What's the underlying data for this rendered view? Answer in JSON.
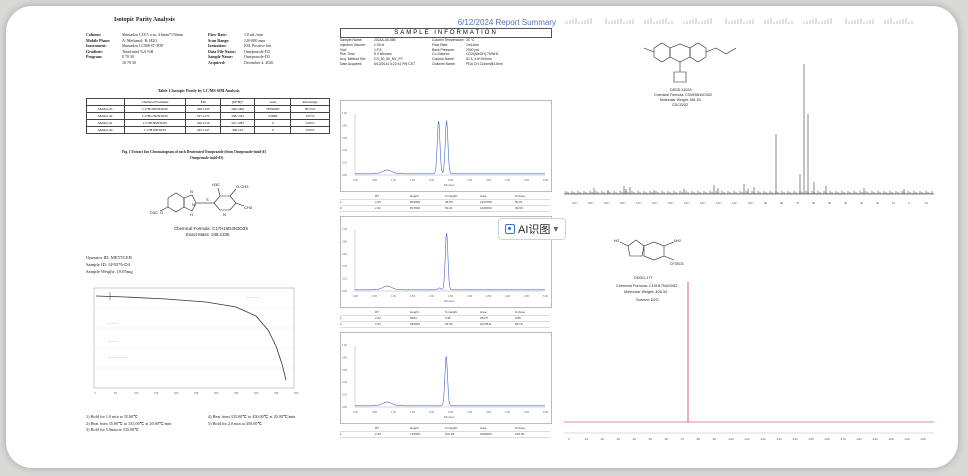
{
  "left_doc": {
    "title": "Isotopic Parity Analysis",
    "params_left": [
      {
        "label": "Column:",
        "value": "Shimadzu C18 5 u m, 4.6mm*150mm"
      },
      {
        "label": "Mobile Phase:",
        "value": "A: Methanol; B: H2O"
      },
      {
        "label": "Instrument:",
        "value": "Shimadzu LCMS-IT-TOF"
      },
      {
        "label": "Gradient:",
        "value": "Time(min)    %A      %B"
      },
      {
        "label": "Program:",
        "value": "0             70      30"
      },
      {
        "label": "",
        "value": "10            70      30"
      }
    ],
    "params_right": [
      {
        "label": "Flow Rate:",
        "value": "1.0 mL/min"
      },
      {
        "label": "Scan Range:",
        "value": "120-800 amu"
      },
      {
        "label": "Ionization:",
        "value": "ESI, Positive Ion"
      },
      {
        "label": "Data File Name:",
        "value": "Omeprazole-D3"
      },
      {
        "label": "Sample Name:",
        "value": "Omeprazole-D3"
      },
      {
        "label": "Acquired:",
        "value": "December 4, 2020"
      }
    ],
    "table_title": "Table 1.Isotopic Purity by LC/MS SIM Analysis",
    "table_headers": [
      "",
      "Chemical Formulae",
      "EM",
      "[M+H]+",
      "Area",
      "Percentage"
    ],
    "table_rows": [
      [
        "Methyl-d3",
        "C17H16D3N3O3S",
        "348.1335",
        "349.1408",
        "78700287",
        "99.55%"
      ],
      [
        "Methyl-d2",
        "C17H17D2N3O3S",
        "347.1273",
        "348.1345",
        "52868",
        "0.07%"
      ],
      [
        "Methyl-d1",
        "C17H18DN3O3S",
        "346.1210",
        "347.1283",
        "0",
        "0.00%"
      ],
      [
        "Methyl-d0",
        "C17H19N3O3S",
        "345.1147",
        "346.122",
        "0",
        "0.00%"
      ]
    ],
    "fig_caption": "Fig. 1   Extract Ion Chromatogram of each Deuterated Omeprazole (from Omeprazole-imid-d3",
    "fig_caption2": "Omeprazole-imid-d3)",
    "structure": {
      "formula": "Chemical Formula: C17H16D3N3O3S",
      "mass": "Exact Mass: 348.1335",
      "labels": [
        "D3C",
        "O",
        "N",
        "H",
        "H3C",
        "O-CH3",
        "CH3",
        "N",
        "S",
        "N"
      ]
    },
    "tga_info": [
      {
        "label": "Operator ID: ",
        "value": "METTLER"
      },
      {
        "label": "Sample ID: ",
        "value": "LF0376-D4"
      },
      {
        "label": "Sample Weight: ",
        "value": "10.05mg"
      }
    ],
    "tga_notes_left": [
      "1) Hold for 1.0 min at 35.00℃",
      "2) Heat from 35.00℃ to 335.00℃ at 20.00℃/min",
      "3) Hold for 5.0min at 335.00℃"
    ],
    "tga_notes_right": [
      "4) Heat from 335.00℃ to 450.00℃ at 20.00℃/min",
      "5) Hold for 2.0 min at 450.00℃"
    ]
  },
  "mid_doc": {
    "header_title": "6/12/2024 Report Summary",
    "section_title": "SAMPLE INFORMATION",
    "info_left": [
      [
        "Sample Name:",
        "2024A-05-086"
      ],
      [
        "Injection Volume:",
        "1.00 ul"
      ],
      [
        "Vial:",
        "1:F,8"
      ],
      [
        "Run Time:",
        "5.0 Minutes"
      ],
      [
        "Acq. Method Set:",
        "CS_50_50_ML_FF"
      ],
      [
        "Date Acquired:",
        "6/12/2024 5:22:41 PM CST"
      ]
    ],
    "info_right": [
      [
        "Column Temperature:",
        "30 °C"
      ],
      [
        "Flow Rate:",
        "1mL/min"
      ],
      [
        "Back Pressure:",
        "2000 psi"
      ],
      [
        "Co-Solvent:",
        "CO2/(MeOH) 75/NH3"
      ],
      [
        "Column Name:",
        "ID-3, 4.6*100mm"
      ],
      [
        "Channel Name:",
        "PDA CH 214nm@4.8nm"
      ]
    ],
    "peak_header": [
      "RT",
      "Height",
      "% Height",
      "Area",
      "% Area"
    ],
    "peak_tables": [
      [
        [
          "1",
          "2.20",
          "803000",
          "49.59",
          "1207000",
          "50.01"
        ],
        [
          "2",
          "2.41",
          "817000",
          "50.41",
          "1206000",
          "49.99"
        ]
      ],
      [
        [
          "1",
          "2.22",
          "9004",
          "0.95",
          "28177",
          "0.85"
        ],
        [
          "2",
          "2.41",
          "940000",
          "99.05",
          "3272511",
          "99.15"
        ]
      ],
      [
        [
          "1",
          "2.40",
          "718000",
          "100.00",
          "3206000",
          "100.00"
        ]
      ]
    ],
    "xaxis_label": "Minutes"
  },
  "right_doc": {
    "nmr1": {
      "compound_id": "DDDD-1102A",
      "formula": "Chemical Formula: C30H36N4O4S2",
      "mw": "Molecular Weight: 581.03",
      "solvent": "CDCl3/D2"
    },
    "nmr2": {
      "compound_id": "DDDD-177",
      "formula": "Chemical Formula: C10H17N4O4S2",
      "mw": "Molecular Weight: 408.34",
      "solvent": "Solvent: D2O"
    },
    "axis1_ticks": [
      "210",
      "200",
      "190",
      "180",
      "170",
      "160",
      "150",
      "140",
      "130",
      "120",
      "110",
      "100",
      "90",
      "80",
      "70",
      "60",
      "50",
      "40",
      "30",
      "20",
      "10",
      "0",
      "-10"
    ],
    "axis2_ticks": [
      "0",
      "-10",
      "-20",
      "-30",
      "-40",
      "-50",
      "-60",
      "-70",
      "-80",
      "-90",
      "-100",
      "-110",
      "-120",
      "-130",
      "-140",
      "-150",
      "-160",
      "-170",
      "-180",
      "-190",
      "-200",
      "-210",
      "-220"
    ]
  },
  "overlay": {
    "ai_label": "AI识图",
    "dropdown": "▾"
  },
  "colors": {
    "trace_blue": "#4a63c8",
    "nmr_black": "#111111",
    "nmr_red": "#c81e1e",
    "card_bg": "#ffffff",
    "page_bg": "#d9dad8"
  }
}
